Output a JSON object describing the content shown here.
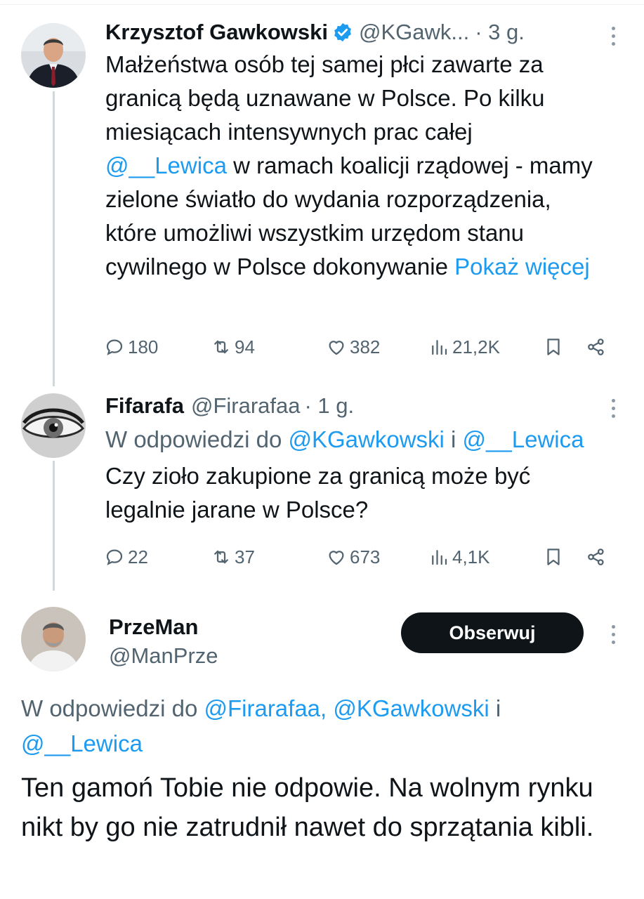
{
  "tweets": [
    {
      "name": "Krzysztof Gawkowski",
      "handle": "@KGawk...",
      "time": "· 3 g.",
      "text_before": "Małżeństwa osób tej samej płci zawarte za granicą będą uznawane w Polsce. Po kilku miesiącach intensywnych prac całej",
      "mention": "@__Lewica",
      "text_after": " w ramach koalicji rządowej - mamy zielone światło do wydania rozporządzenia, które umożliwi wszystkim urzędom stanu cywilnego w Polsce dokonywanie ",
      "show_more": "Pokaż więcej",
      "replies": "180",
      "retweets": "94",
      "likes": "382",
      "views": "21,2K"
    },
    {
      "name": "Fifarafa",
      "handle": "@Firarafaa",
      "time": "· 1 g.",
      "reply_prefix": "W odpowiedzi do ",
      "reply_to_1": "@KGawkowski",
      "reply_and": " i ",
      "reply_to_2": "@__Lewica",
      "text": "Czy zioło zakupione za granicą może być legalnie jarane w Polsce?",
      "replies": "22",
      "retweets": "37",
      "likes": "673",
      "views": "4,1K"
    }
  ],
  "main": {
    "name": "PrzeMan",
    "handle": "@ManPrze",
    "follow_label": "Obserwuj",
    "reply_prefix": "W odpowiedzi do ",
    "reply_to_1": "@Firarafaa, @KGawkowski",
    "reply_and": " i",
    "reply_to_2": "@__Lewica",
    "text": "Ten gamoń Tobie nie odpowie. Na wolnym rynku nikt by go nie zatrudnił nawet do sprzątania kibli."
  },
  "colors": {
    "link": "#1d9bf0",
    "muted": "#536471",
    "button": "#0f1419"
  }
}
